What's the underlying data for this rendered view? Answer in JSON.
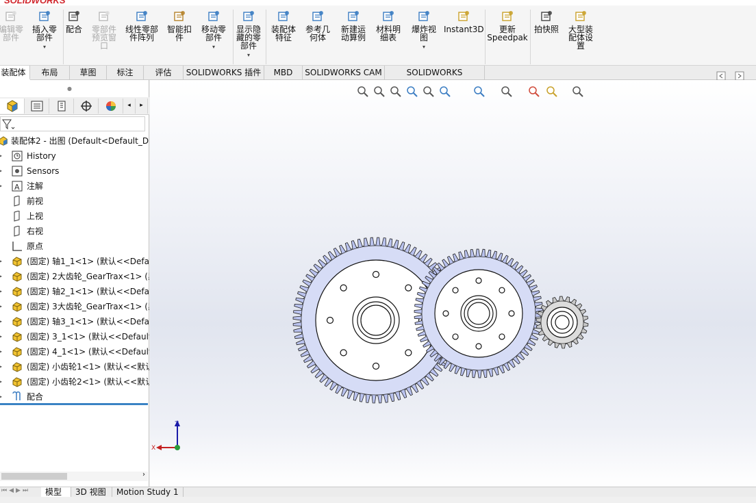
{
  "app": {
    "brand": "SOLIDWORKS",
    "brand_color": "#d1262c"
  },
  "ribbon": {
    "items": [
      {
        "label": "编辑零\n部件",
        "icon": "edit-component-icon",
        "disabled": true
      },
      {
        "label": "插入零\n部件",
        "icon": "insert-component-icon",
        "disabled": false
      },
      {
        "label": "配合",
        "icon": "mate-icon",
        "disabled": false
      },
      {
        "label": "零部件\n预览窗\n口",
        "icon": "component-preview-icon",
        "disabled": true
      },
      {
        "label": "线性零部\n件阵列",
        "icon": "linear-pattern-icon",
        "disabled": false
      },
      {
        "label": "智能扣\n件",
        "icon": "smart-fastener-icon",
        "disabled": false
      },
      {
        "label": "移动零\n部件",
        "icon": "move-component-icon",
        "disabled": false
      },
      {
        "label": "显示隐\n藏的零\n部件",
        "icon": "show-hidden-icon",
        "disabled": false
      },
      {
        "label": "装配体\n特征",
        "icon": "assembly-feature-icon",
        "disabled": false
      },
      {
        "label": "参考几\n何体",
        "icon": "reference-geometry-icon",
        "disabled": false
      },
      {
        "label": "新建运\n动算例",
        "icon": "new-motion-study-icon",
        "disabled": false
      },
      {
        "label": "材料明\n细表",
        "icon": "bom-icon",
        "disabled": false
      },
      {
        "label": "爆炸视\n图",
        "icon": "exploded-view-icon",
        "disabled": false
      },
      {
        "label": "Instant3D",
        "icon": "instant3d-icon",
        "disabled": false
      },
      {
        "label": "更新\nSpeedpak",
        "icon": "speedpak-icon",
        "disabled": false
      },
      {
        "label": "拍快照",
        "icon": "snapshot-icon",
        "disabled": false
      },
      {
        "label": "大型装\n配体设\n置",
        "icon": "large-assembly-icon",
        "disabled": false
      }
    ]
  },
  "tabs": [
    "装配体",
    "布局",
    "草图",
    "标注",
    "评估",
    "SOLIDWORKS 插件",
    "MBD",
    "SOLIDWORKS CAM",
    "SOLIDWORKS Inspection"
  ],
  "tree": {
    "root": "装配体2 - 出图  (Default<Default_Di",
    "items": [
      {
        "label": "History",
        "icon": "history-icon"
      },
      {
        "label": "Sensors",
        "icon": "sensors-icon"
      },
      {
        "label": "注解",
        "icon": "annotations-icon"
      },
      {
        "label": "前视",
        "icon": "plane-icon"
      },
      {
        "label": "上视",
        "icon": "plane-icon"
      },
      {
        "label": "右视",
        "icon": "plane-icon"
      },
      {
        "label": "原点",
        "icon": "origin-icon"
      },
      {
        "label": "(固定) 轴1_1<1> (默认<<Defau",
        "icon": "part-icon"
      },
      {
        "label": "(固定) 2大齿轮_GearTrax<1> (黑",
        "icon": "part-icon"
      },
      {
        "label": "(固定) 轴2_1<1> (默认<<Defau",
        "icon": "part-icon"
      },
      {
        "label": "(固定) 3大齿轮_GearTrax<1> (黑",
        "icon": "part-icon"
      },
      {
        "label": "(固定) 轴3_1<1> (默认<<Defau",
        "icon": "part-icon"
      },
      {
        "label": "(固定) 3_1<1> (默认<<Default>",
        "icon": "part-icon"
      },
      {
        "label": "(固定) 4_1<1> (默认<<Default>",
        "icon": "part-icon"
      },
      {
        "label": "(固定) 小齿轮1<1> (默认<<默认",
        "icon": "part-icon"
      },
      {
        "label": "(固定) 小齿轮2<1> (默认<<默认",
        "icon": "part-icon"
      },
      {
        "label": "配合",
        "icon": "mates-icon"
      }
    ]
  },
  "bottom_tabs": [
    "模型",
    "3D 视图",
    "Motion Study 1"
  ],
  "triad": {
    "z": "Z",
    "x": "X"
  },
  "colors": {
    "gear_fill": "#d6dcf6",
    "gear_tooth": "#b9c2ee",
    "accent": "#3a83c4"
  }
}
